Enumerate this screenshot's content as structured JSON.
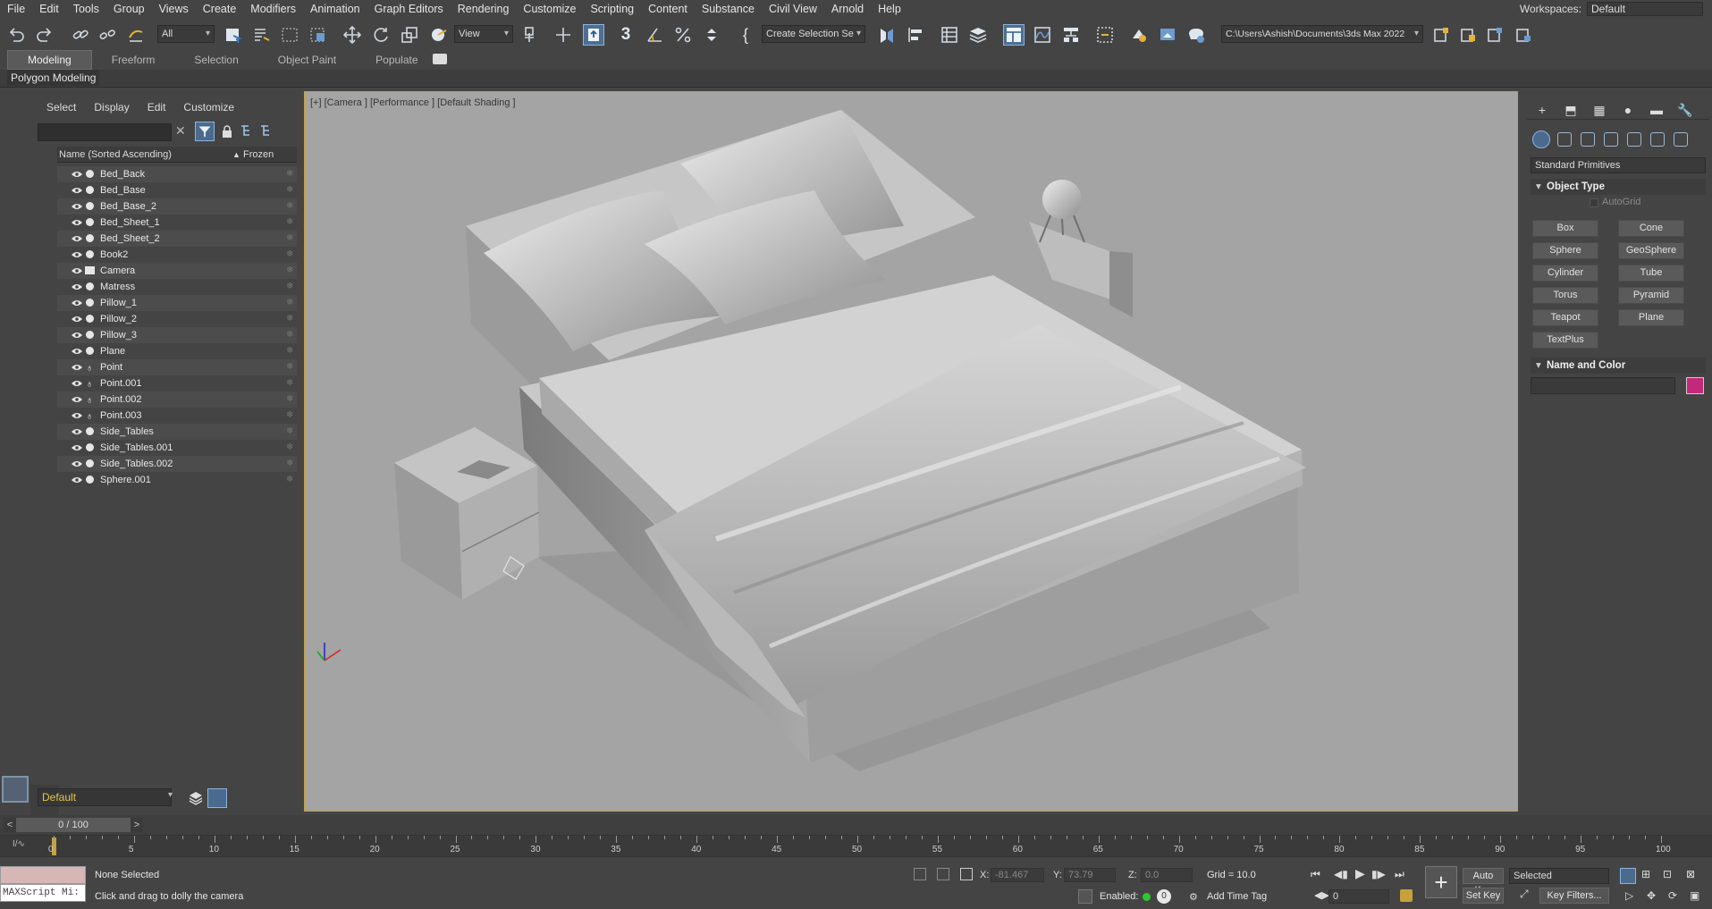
{
  "menu": [
    "File",
    "Edit",
    "Tools",
    "Group",
    "Views",
    "Create",
    "Modifiers",
    "Animation",
    "Graph Editors",
    "Rendering",
    "Customize",
    "Scripting",
    "Content",
    "Substance",
    "Civil View",
    "Arnold",
    "Help"
  ],
  "workspace": {
    "label": "Workspaces:",
    "value": "Default"
  },
  "toolbar": {
    "selection_filter": "All",
    "ref_coord": "View",
    "named_selection": "Create Selection Se",
    "project_path": "C:\\Users\\Ashish\\Documents\\3ds Max 2022",
    "snap_3": "3",
    "brace": "{"
  },
  "ribbon": {
    "tabs": [
      "Modeling",
      "Freeform",
      "Selection",
      "Object Paint",
      "Populate"
    ],
    "panel": "Polygon Modeling"
  },
  "scene_explorer": {
    "tabs": [
      "Select",
      "Display",
      "Edit",
      "Customize"
    ],
    "col_name": "Name (Sorted Ascending)",
    "col_frozen": "Frozen",
    "sort_arrow": "▲",
    "objects": [
      "Bed_Back",
      "Bed_Base",
      "Bed_Base_2",
      "Bed_Sheet_1",
      "Bed_Sheet_2",
      "Book2",
      "Camera",
      "Matress",
      "Pillow_1",
      "Pillow_2",
      "Pillow_3",
      "Plane",
      "Point",
      "Point.001",
      "Point.002",
      "Point.003",
      "Side_Tables",
      "Side_Tables.001",
      "Side_Tables.002",
      "Sphere.001"
    ],
    "layer": "Default"
  },
  "viewport": {
    "label": "[+] [Camera ] [Performance ] [Default Shading ]"
  },
  "command_panel": {
    "category": "Standard Primitives",
    "object_type_title": "Object Type",
    "autogrid": "AutoGrid",
    "buttons": [
      "Box",
      "Cone",
      "Sphere",
      "GeoSphere",
      "Cylinder",
      "Tube",
      "Torus",
      "Pyramid",
      "Teapot",
      "Plane",
      "TextPlus"
    ],
    "name_color_title": "Name and Color",
    "swatch_color": "#c4287a"
  },
  "timeline": {
    "frame_counter": "0 / 100",
    "prev": "<",
    "next": ">",
    "ticks": [
      "0",
      "5",
      "10",
      "15",
      "20",
      "25",
      "30",
      "35",
      "40",
      "45",
      "50",
      "55",
      "60",
      "65",
      "70",
      "75",
      "80",
      "85",
      "90",
      "95",
      "100"
    ]
  },
  "status": {
    "maxscript": "MAXScript Mi:",
    "selection": "None Selected",
    "prompt": "Click and drag to dolly the camera",
    "x_label": "X:",
    "x_value": "-81.467",
    "y_label": "Y:",
    "y_value": "73.79",
    "z_label": "Z:",
    "z_value": "0.0",
    "grid": "Grid = 10.0",
    "enabled": "Enabled:",
    "enabled_count": "0",
    "add_time_tag": "Add Time Tag",
    "auto_key": "Auto Key",
    "set_key": "Set Key",
    "key_mode": "Selected",
    "key_filters": "Key Filters...",
    "frame": "0"
  }
}
